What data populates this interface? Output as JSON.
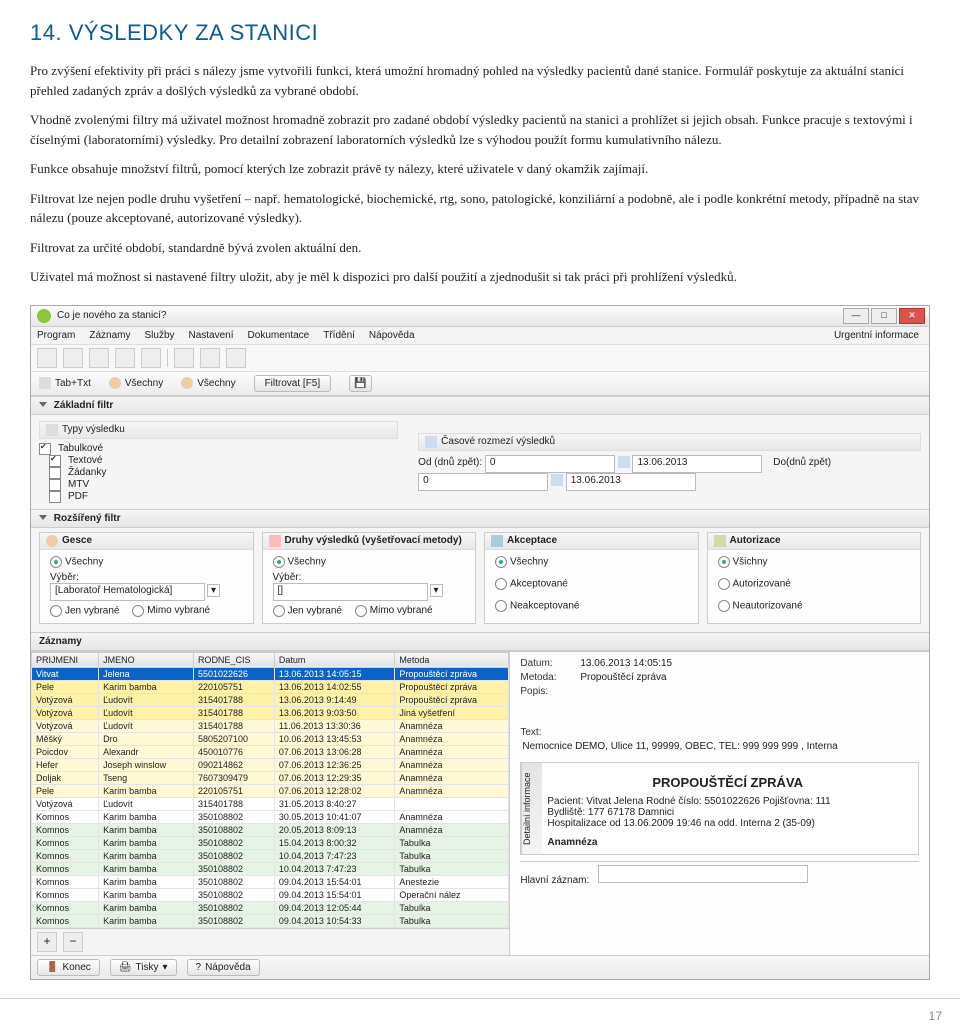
{
  "doc": {
    "heading": "14. VÝSLEDKY ZA STANICI",
    "p1": "Pro zvýšení efektivity při práci s nálezy jsme vytvořili funkci, která umožní hromadný pohled na výsledky pacientů dané stanice. Formulář poskytuje za aktuální stanici přehled zadaných zpráv a došlých výsledků za vybrané období.",
    "p2": "Vhodně zvolenými filtry má uživatel možnost hromadně zobrazit pro zadané období výsledky pacientů na stanici a prohlížet si jejich obsah. Funkce pracuje s textovými i číselnými (laboratorními) výsledky. Pro detailní zobrazení laboratorních výsledků lze s výhodou použít formu kumulativního nálezu.",
    "p3": "Funkce obsahuje množství filtrů, pomocí kterých lze zobrazit právě ty nálezy, které uživatele v daný okamžik zajímají.",
    "p4": "Filtrovat lze nejen podle druhu vyšetření – např. hematologické, biochemické, rtg, sono, patologické, konziliární a podobně, ale i podle konkrétní metody, případně na stav nálezu (pouze akceptované, autorizované výsledky).",
    "p5": "Filtrovat za určité období, standardně bývá zvolen aktuální den.",
    "p6": "Uživatel má možnost si nastavené filtry uložit, aby je měl k dispozici pro další použití a zjednodušit si tak práci při prohlížení výsledků.",
    "page_number": "17"
  },
  "app": {
    "title": "Co je nového za stanicí?",
    "urgent": "Urgentní informace",
    "menu": [
      "Program",
      "Záznamy",
      "Služby",
      "Nastavení",
      "Dokumentace",
      "Třídění",
      "Nápověda"
    ],
    "filterbar": {
      "tabtxt": "Tab+Txt",
      "vsechny1": "Všechny",
      "vsechny2": "Všechny",
      "filtrovat": "Filtrovat [F5]"
    },
    "basic_filter_head": "Základní filtr",
    "types_head": "Typy výsledku",
    "time_head": "Časové rozmezí výsledků",
    "types": {
      "tabulkove": "Tabulkové",
      "textove": "Textové",
      "zadanky": "Žádanky",
      "mtv": "MTV",
      "pdf": "PDF"
    },
    "time": {
      "od_back": "Od (dnů zpět):",
      "od_back_val": "0",
      "date1": "13.06.2013",
      "do_back": "Do(dnů zpět)",
      "do_back_val": "0",
      "date2": "13.06.2013"
    },
    "ext_filter_head": "Rozšířený filtr",
    "groups": {
      "gesce": {
        "head": "Gesce",
        "vsechny": "Všechny",
        "vyber": "Výběr:",
        "value": "[Laboratoř Hematologická]",
        "jen": "Jen vybrané",
        "mimo": "Mimo vybrané"
      },
      "druhy": {
        "head": "Druhy výsledků (vyšetřovací metody)",
        "vsechny": "Všechny",
        "vyber": "Výběr:",
        "value": "[]",
        "jen": "Jen vybrané",
        "mimo": "Mimo vybrané"
      },
      "akceptace": {
        "head": "Akceptace",
        "vsechny": "Všechny",
        "ak": "Akceptované",
        "neak": "Neakceptované"
      },
      "autorizace": {
        "head": "Autorizace",
        "vsechny": "Všichny",
        "aut": "Autorizované",
        "neaut": "Neautorizované"
      }
    },
    "records_head": "Záznamy",
    "columns": [
      "PRIJMENI",
      "JMENO",
      "RODNE_CIS",
      "Datum",
      "Metoda"
    ],
    "rows": [
      {
        "cls": "sel",
        "c": [
          "Vitvat",
          "Jelena",
          "5501022626",
          "13.06.2013 14:05:15",
          "Propouštěcí zpráva"
        ]
      },
      {
        "cls": "hl",
        "c": [
          "Pele",
          "Karim bamba",
          "220105751",
          "13.06.2013 14:02:55",
          "Propouštěcí zpráva"
        ]
      },
      {
        "cls": "hl",
        "c": [
          "Votýzová",
          "Ľudovít",
          "315401788",
          "13.06.2013 9:14:49",
          "Propouštěcí zpráva"
        ]
      },
      {
        "cls": "hl",
        "c": [
          "Votýzová",
          "Ľudovít",
          "315401788",
          "13.06.2013 9:03:50",
          "Jiná vyšetření"
        ]
      },
      {
        "cls": "hl2",
        "c": [
          "Votýzová",
          "Ľudovít",
          "315401788",
          "11.06.2013 13:30:36",
          "Anamnéza"
        ]
      },
      {
        "cls": "hl2",
        "c": [
          "Měšký",
          "Dro",
          "5805207100",
          "10.06.2013 13:45:53",
          "Anamnéza"
        ]
      },
      {
        "cls": "hl2",
        "c": [
          "Poicdov",
          "Alexandr",
          "450010776",
          "07.06.2013 13:06:28",
          "Anamnéza"
        ]
      },
      {
        "cls": "hl2",
        "c": [
          "Hefer",
          "Joseph winslow",
          "090214862",
          "07.06.2013 12:36:25",
          "Anamnéza"
        ]
      },
      {
        "cls": "hl2",
        "c": [
          "Doljak",
          "Tseng",
          "7607309479",
          "07.06.2013 12:29:35",
          "Anamnéza"
        ]
      },
      {
        "cls": "hl2",
        "c": [
          "Pele",
          "Karim bamba",
          "220105751",
          "07.06.2013 12:28:02",
          "Anamnéza"
        ]
      },
      {
        "cls": "",
        "c": [
          "Votýzová",
          "Ľudovít",
          "315401788",
          "31.05.2013 8:40:27",
          ""
        ]
      },
      {
        "cls": "",
        "c": [
          "Komnos",
          "Karim bamba",
          "350108802",
          "30.05.2013 10:41:07",
          "Anamnéza"
        ]
      },
      {
        "cls": "pale",
        "c": [
          "Komnos",
          "Karim bamba",
          "350108802",
          "20.05.2013 8:09:13",
          "Anamnéza"
        ]
      },
      {
        "cls": "pale",
        "c": [
          "Komnos",
          "Karim bamba",
          "350108802",
          "15.04.2013 8:00:32",
          "Tabulka"
        ]
      },
      {
        "cls": "pale",
        "c": [
          "Komnos",
          "Karim bamba",
          "350108802",
          "10.04.2013 7:47:23",
          "Tabulka"
        ]
      },
      {
        "cls": "pale",
        "c": [
          "Komnos",
          "Karim bamba",
          "350108802",
          "10.04.2013 7:47:23",
          "Tabulka"
        ]
      },
      {
        "cls": "",
        "c": [
          "Komnos",
          "Karim bamba",
          "350108802",
          "09.04.2013 15:54:01",
          "Anestezie"
        ]
      },
      {
        "cls": "",
        "c": [
          "Komnos",
          "Karim bamba",
          "350108802",
          "09.04.2013 15:54:01",
          "Operační nález"
        ]
      },
      {
        "cls": "pale",
        "c": [
          "Komnos",
          "Karim bamba",
          "350108802",
          "09.04.2013 12:05:44",
          "Tabulka"
        ]
      },
      {
        "cls": "pale",
        "c": [
          "Komnos",
          "Karim bamba",
          "350108802",
          "09.04.2013 10:54:33",
          "Tabulka"
        ]
      }
    ],
    "detail": {
      "datum_l": "Datum:",
      "datum_v": "13.06.2013 14:05:15",
      "metoda_l": "Metoda:",
      "metoda_v": "Propouštěcí zpráva",
      "popis_l": "Popis:",
      "text_l": "Text:",
      "text_v": "Nemocnice DEMO, Ulice 11, 99999, OBEC, TEL: 999 999 999 , Interna",
      "report_title": "PROPOUŠTĚCÍ ZPRÁVA",
      "pacient": "Pacient:  Vitvat Jelena        Rodné číslo: 5501022626      Pojišťovna: 111",
      "bydliste": "Bydliště:  177   67178 Damnici",
      "hosp": "Hospitalizace od 13.06.2009 19:46 na odd. Interna 2 (35-09)",
      "anamneza": "Anamnéza",
      "side_tab": "Detailní informace"
    },
    "status": {
      "head": "Hlavní záznam:",
      "konec": "Konec",
      "tisky": "Tisky",
      "napoveda": "Nápověda"
    }
  }
}
